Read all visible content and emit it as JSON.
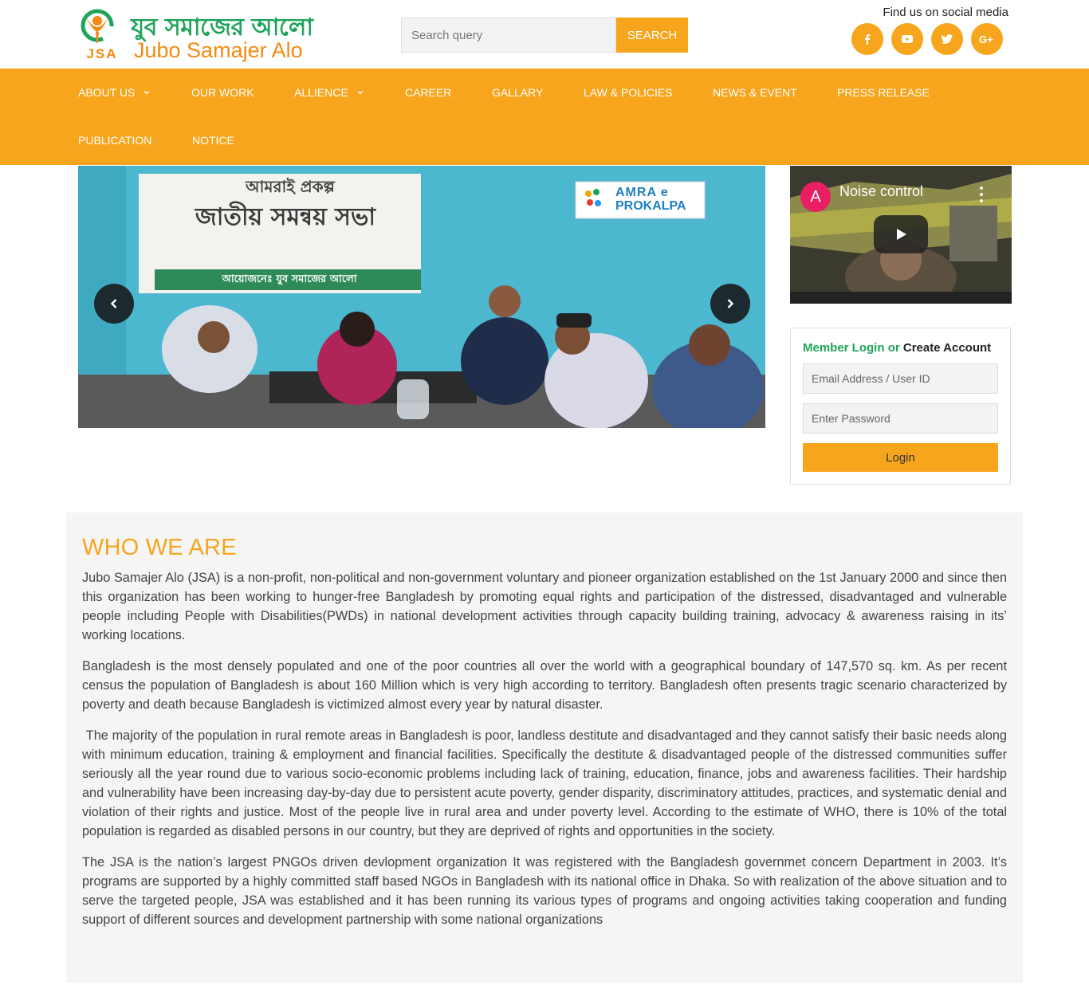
{
  "brand": {
    "logo_letters": "JSA",
    "name_bangla": "যুব সমাজের আলো",
    "name_english": "Jubo Samajer Alo"
  },
  "search": {
    "placeholder": "Search query",
    "button_label": "SEARCH"
  },
  "social": {
    "label": "Find us on social media",
    "icons": [
      "facebook-icon",
      "youtube-icon",
      "twitter-icon",
      "google-plus-icon"
    ]
  },
  "nav": {
    "items": [
      {
        "label": "ABOUT US",
        "has_dropdown": true
      },
      {
        "label": "OUR WORK",
        "has_dropdown": false
      },
      {
        "label": "ALLIENCE",
        "has_dropdown": true
      },
      {
        "label": "CAREER",
        "has_dropdown": false
      },
      {
        "label": "GALLARY",
        "has_dropdown": false
      },
      {
        "label": "LAW & POLICIES",
        "has_dropdown": false
      },
      {
        "label": "NEWS & EVENT",
        "has_dropdown": false
      },
      {
        "label": "PRESS RELEASE",
        "has_dropdown": false
      },
      {
        "label": "PUBLICATION",
        "has_dropdown": false
      },
      {
        "label": "NOTICE",
        "has_dropdown": false
      }
    ]
  },
  "slider": {
    "banner_line1": "আমরাই প্রকল্প",
    "banner_line2": "জাতীয় সমন্বয় সভা",
    "banner_org": "আয়োজনেঃ যুব সমাজের আলো",
    "badge_line1": "AMRA e",
    "badge_line2": "PROKALPA"
  },
  "video": {
    "channel_initial": "A",
    "title": "Noise control"
  },
  "login": {
    "heading_part1": "Member Login",
    "heading_or": "or",
    "heading_part2": "Create Account",
    "email_placeholder": "Email Address / User ID",
    "password_placeholder": "Enter Password",
    "button_label": "Login"
  },
  "about": {
    "heading": "WHO WE ARE",
    "paragraphs": [
      "Jubo Samajer Alo (JSA) is a non-profit, non-political and non-government voluntary and pioneer organization established on the 1st January 2000 and since then this organization has been working to hunger-free Bangladesh by promoting equal rights and participation of the distressed, disadvantaged and vulnerable people including People with Disabilities(PWDs) in national development activities through capacity building training, advocacy & awareness raising in its’ working locations.",
      "Bangladesh is the most densely populated and one of the poor countries all over the world with a geographical boundary of 147,570 sq. km. As per recent census the population of Bangladesh is about 160 Million which is very high according to territory. Bangladesh often presents tragic scenario characterized by poverty and death because Bangladesh is victimized almost every year by natural disaster.",
      " The majority of the population in rural remote areas in Bangladesh is poor, landless destitute and disadvantaged and they cannot satisfy their basic needs along with minimum education, training & employment and financial facilities. Specifically the destitute & disadvantaged people of the distressed communities suffer seriously all the year round due to various socio-economic problems including lack of training, education, finance, jobs and awareness facilities. Their hardship and vulnerability have been increasing day-by-day due to persistent acute poverty, gender disparity, discriminatory attitudes, practices, and systematic denial and violation of their rights and justice. Most of the people live in rural area and under poverty level. According to the estimate of WHO, there is 10% of the total population is regarded as disabled persons in our country, but they are deprived of rights and opportunities in the society.",
      "The JSA is the nation’s largest PNGOs driven devlopment organization It was registered with the Bangladesh governmet concern Department in 2003. It’s programs are supported by a highly committed staff based NGOs in Bangladesh with its national office in Dhaka. So with realization of the above situation and to serve the targeted people, JSA was established and it has been running its various types of programs and ongoing activities taking cooperation and funding support of different sources and development partnership with some national organizations"
    ]
  }
}
